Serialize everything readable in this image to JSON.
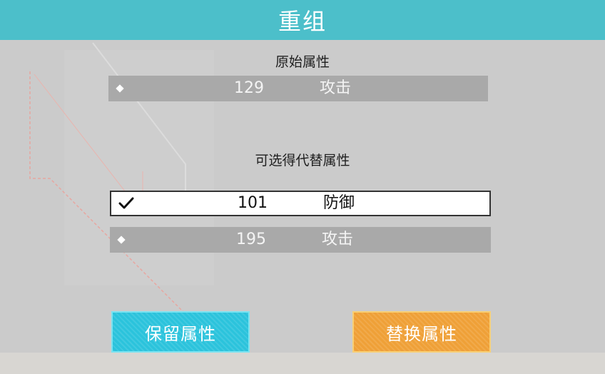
{
  "dialog": {
    "title": "重组"
  },
  "original": {
    "heading": "原始属性",
    "attribute": {
      "value": "129",
      "name": "攻击"
    }
  },
  "alternatives": {
    "heading": "可选得代替属性",
    "options": [
      {
        "value": "101",
        "name": "防御",
        "selected": true
      },
      {
        "value": "195",
        "name": "攻击",
        "selected": false
      }
    ]
  },
  "buttons": {
    "keep_label": "保留属性",
    "replace_label": "替换属性"
  },
  "colors": {
    "title_bar": "#4cbfca",
    "keep_button": "#2bc3dc",
    "replace_button": "#efa037",
    "panel": "#cbcbcb",
    "row": "#a9a9a9"
  }
}
